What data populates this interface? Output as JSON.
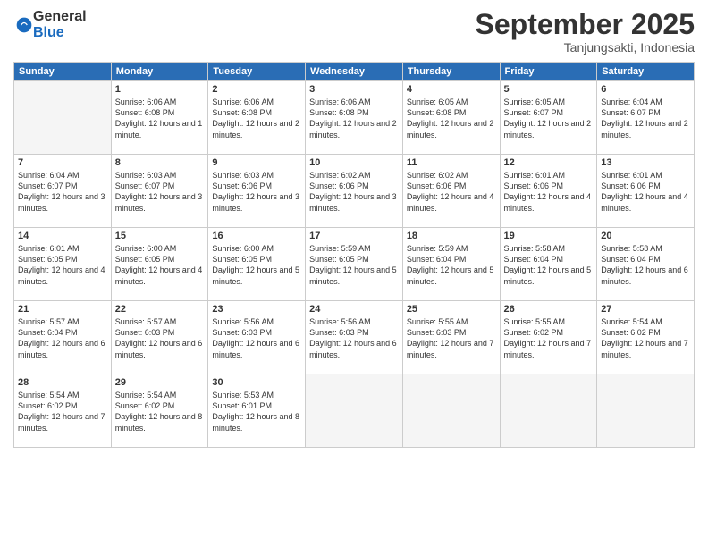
{
  "logo": {
    "general": "General",
    "blue": "Blue"
  },
  "header": {
    "month": "September 2025",
    "location": "Tanjungsakti, Indonesia"
  },
  "weekdays": [
    "Sunday",
    "Monday",
    "Tuesday",
    "Wednesday",
    "Thursday",
    "Friday",
    "Saturday"
  ],
  "weeks": [
    [
      {
        "day": "",
        "empty": true
      },
      {
        "day": "1",
        "sunrise": "6:06 AM",
        "sunset": "6:08 PM",
        "daylight": "12 hours and 1 minute."
      },
      {
        "day": "2",
        "sunrise": "6:06 AM",
        "sunset": "6:08 PM",
        "daylight": "12 hours and 2 minutes."
      },
      {
        "day": "3",
        "sunrise": "6:06 AM",
        "sunset": "6:08 PM",
        "daylight": "12 hours and 2 minutes."
      },
      {
        "day": "4",
        "sunrise": "6:05 AM",
        "sunset": "6:08 PM",
        "daylight": "12 hours and 2 minutes."
      },
      {
        "day": "5",
        "sunrise": "6:05 AM",
        "sunset": "6:07 PM",
        "daylight": "12 hours and 2 minutes."
      },
      {
        "day": "6",
        "sunrise": "6:04 AM",
        "sunset": "6:07 PM",
        "daylight": "12 hours and 2 minutes."
      }
    ],
    [
      {
        "day": "7",
        "sunrise": "6:04 AM",
        "sunset": "6:07 PM",
        "daylight": "12 hours and 3 minutes."
      },
      {
        "day": "8",
        "sunrise": "6:03 AM",
        "sunset": "6:07 PM",
        "daylight": "12 hours and 3 minutes."
      },
      {
        "day": "9",
        "sunrise": "6:03 AM",
        "sunset": "6:06 PM",
        "daylight": "12 hours and 3 minutes."
      },
      {
        "day": "10",
        "sunrise": "6:02 AM",
        "sunset": "6:06 PM",
        "daylight": "12 hours and 3 minutes."
      },
      {
        "day": "11",
        "sunrise": "6:02 AM",
        "sunset": "6:06 PM",
        "daylight": "12 hours and 4 minutes."
      },
      {
        "day": "12",
        "sunrise": "6:01 AM",
        "sunset": "6:06 PM",
        "daylight": "12 hours and 4 minutes."
      },
      {
        "day": "13",
        "sunrise": "6:01 AM",
        "sunset": "6:06 PM",
        "daylight": "12 hours and 4 minutes."
      }
    ],
    [
      {
        "day": "14",
        "sunrise": "6:01 AM",
        "sunset": "6:05 PM",
        "daylight": "12 hours and 4 minutes."
      },
      {
        "day": "15",
        "sunrise": "6:00 AM",
        "sunset": "6:05 PM",
        "daylight": "12 hours and 4 minutes."
      },
      {
        "day": "16",
        "sunrise": "6:00 AM",
        "sunset": "6:05 PM",
        "daylight": "12 hours and 5 minutes."
      },
      {
        "day": "17",
        "sunrise": "5:59 AM",
        "sunset": "6:05 PM",
        "daylight": "12 hours and 5 minutes."
      },
      {
        "day": "18",
        "sunrise": "5:59 AM",
        "sunset": "6:04 PM",
        "daylight": "12 hours and 5 minutes."
      },
      {
        "day": "19",
        "sunrise": "5:58 AM",
        "sunset": "6:04 PM",
        "daylight": "12 hours and 5 minutes."
      },
      {
        "day": "20",
        "sunrise": "5:58 AM",
        "sunset": "6:04 PM",
        "daylight": "12 hours and 6 minutes."
      }
    ],
    [
      {
        "day": "21",
        "sunrise": "5:57 AM",
        "sunset": "6:04 PM",
        "daylight": "12 hours and 6 minutes."
      },
      {
        "day": "22",
        "sunrise": "5:57 AM",
        "sunset": "6:03 PM",
        "daylight": "12 hours and 6 minutes."
      },
      {
        "day": "23",
        "sunrise": "5:56 AM",
        "sunset": "6:03 PM",
        "daylight": "12 hours and 6 minutes."
      },
      {
        "day": "24",
        "sunrise": "5:56 AM",
        "sunset": "6:03 PM",
        "daylight": "12 hours and 6 minutes."
      },
      {
        "day": "25",
        "sunrise": "5:55 AM",
        "sunset": "6:03 PM",
        "daylight": "12 hours and 7 minutes."
      },
      {
        "day": "26",
        "sunrise": "5:55 AM",
        "sunset": "6:02 PM",
        "daylight": "12 hours and 7 minutes."
      },
      {
        "day": "27",
        "sunrise": "5:54 AM",
        "sunset": "6:02 PM",
        "daylight": "12 hours and 7 minutes."
      }
    ],
    [
      {
        "day": "28",
        "sunrise": "5:54 AM",
        "sunset": "6:02 PM",
        "daylight": "12 hours and 7 minutes."
      },
      {
        "day": "29",
        "sunrise": "5:54 AM",
        "sunset": "6:02 PM",
        "daylight": "12 hours and 8 minutes."
      },
      {
        "day": "30",
        "sunrise": "5:53 AM",
        "sunset": "6:01 PM",
        "daylight": "12 hours and 8 minutes."
      },
      {
        "day": "",
        "empty": true
      },
      {
        "day": "",
        "empty": true
      },
      {
        "day": "",
        "empty": true
      },
      {
        "day": "",
        "empty": true
      }
    ]
  ]
}
